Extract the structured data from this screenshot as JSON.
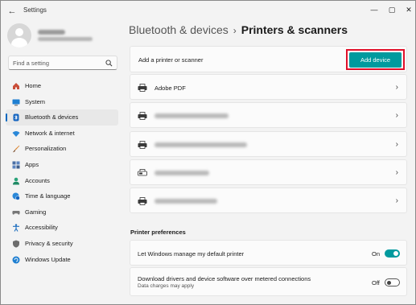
{
  "window": {
    "title": "Settings"
  },
  "search": {
    "placeholder": "Find a setting"
  },
  "sidebar": {
    "items": [
      {
        "label": "Home",
        "icon": "home-icon",
        "active": false
      },
      {
        "label": "System",
        "icon": "monitor-icon",
        "active": false
      },
      {
        "label": "Bluetooth & devices",
        "icon": "bluetooth-icon",
        "active": true
      },
      {
        "label": "Network & internet",
        "icon": "wifi-icon",
        "active": false
      },
      {
        "label": "Personalization",
        "icon": "brush-icon",
        "active": false
      },
      {
        "label": "Apps",
        "icon": "apps-icon",
        "active": false
      },
      {
        "label": "Accounts",
        "icon": "person-icon",
        "active": false
      },
      {
        "label": "Time & language",
        "icon": "globe-clock-icon",
        "active": false
      },
      {
        "label": "Gaming",
        "icon": "gamepad-icon",
        "active": false
      },
      {
        "label": "Accessibility",
        "icon": "accessibility-icon",
        "active": false
      },
      {
        "label": "Privacy & security",
        "icon": "shield-icon",
        "active": false
      },
      {
        "label": "Windows Update",
        "icon": "update-icon",
        "active": false
      }
    ]
  },
  "breadcrumb": {
    "parent": "Bluetooth & devices",
    "separator": "›",
    "current": "Printers & scanners"
  },
  "add_printer": {
    "label": "Add a printer or scanner",
    "button": "Add device"
  },
  "printers": [
    {
      "name": "Adobe PDF"
    },
    {
      "name": ""
    },
    {
      "name": ""
    },
    {
      "name": ""
    },
    {
      "name": ""
    }
  ],
  "preferences": {
    "title": "Printer preferences",
    "manage_default": {
      "label": "Let Windows manage my default printer",
      "state": "On"
    },
    "metered": {
      "label": "Download drivers and device software over metered connections",
      "sub": "Data charges may apply",
      "state": "Off"
    }
  },
  "colors": {
    "accent": "#009a9e",
    "highlight": "#e1102a",
    "nav_indicator": "#0067c0"
  }
}
